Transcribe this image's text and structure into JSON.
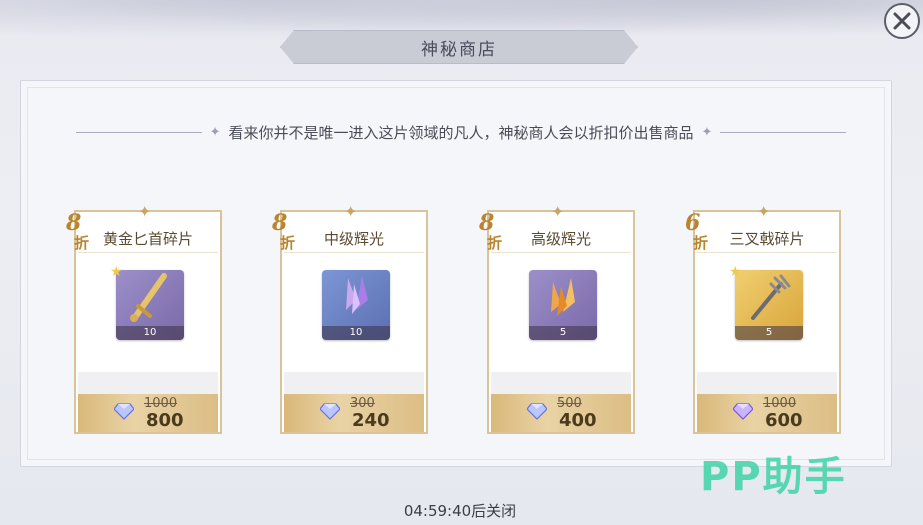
{
  "header": {
    "title": "神秘商店",
    "close_icon": "close-icon"
  },
  "subtitle": "看来你并不是唯一进入这片领域的凡人，神秘商人会以折扣价出售商品",
  "items": [
    {
      "name": "黄金匕首碎片",
      "discount_num": "8",
      "discount_label": "折",
      "quantity": "10",
      "icon": "golden-dagger-shard-icon",
      "icon_color": "#8e7fb8",
      "old_price": "1000",
      "price": "800",
      "has_star": true
    },
    {
      "name": "中级辉光",
      "discount_num": "8",
      "discount_label": "折",
      "quantity": "10",
      "icon": "purple-crystal-icon",
      "icon_color": "#6f86c7",
      "old_price": "300",
      "price": "240",
      "has_star": false
    },
    {
      "name": "高级辉光",
      "discount_num": "8",
      "discount_label": "折",
      "quantity": "5",
      "icon": "orange-crystal-icon",
      "icon_color": "#8e7fb8",
      "old_price": "500",
      "price": "400",
      "has_star": false
    },
    {
      "name": "三叉戟碎片",
      "discount_num": "6",
      "discount_label": "折",
      "quantity": "5",
      "icon": "trident-shard-icon",
      "icon_color": "#e4b54a",
      "old_price": "1000",
      "price": "600",
      "has_star": true
    }
  ],
  "currency_icon": "diamond-gem-icon",
  "countdown": "04:59:40后关闭",
  "watermark": "PP助手"
}
